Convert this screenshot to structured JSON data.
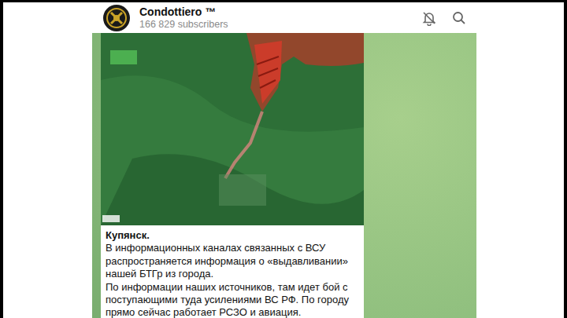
{
  "channel": {
    "title": "Condottiero ™",
    "subscribers": "166 829 subscribers"
  },
  "post": {
    "title": "Купянск.",
    "lines": [
      "В информационных каналах связанных с ВСУ",
      "распространяется информация о «выдавливании»",
      "нашей БТГр из города.",
      "По информации наших источников, там идет бой с",
      "поступающими туда усилениями ВС РФ. По городу",
      "прямо сейчас работает РСЗО и авиация."
    ]
  }
}
